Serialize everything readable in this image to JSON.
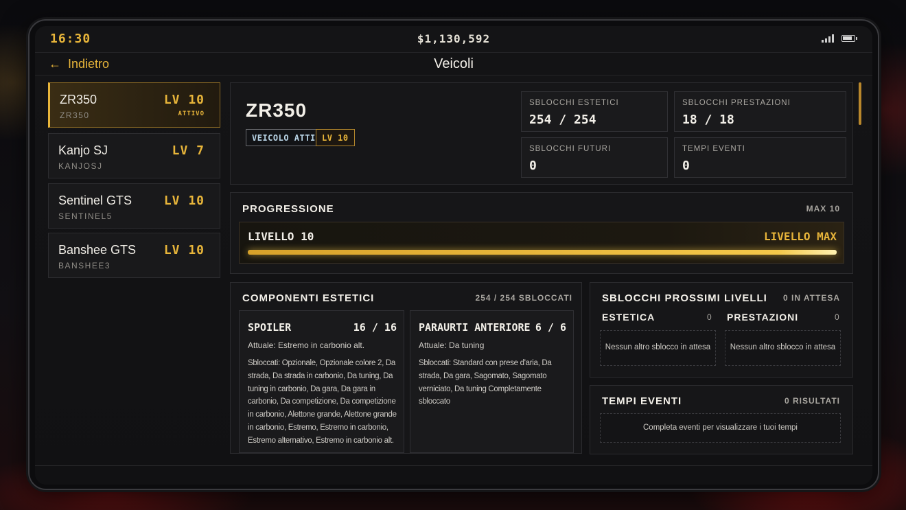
{
  "status": {
    "time": "16:30",
    "money": "$1,130,592"
  },
  "header": {
    "back_label": "Indietro",
    "title": "Veicoli"
  },
  "vehicles": [
    {
      "name": "ZR350",
      "sub": "ZR350",
      "level": "LV 10",
      "badge": "ATTIVO"
    },
    {
      "name": "Kanjo SJ",
      "sub": "KANJOSJ",
      "level": "LV 7"
    },
    {
      "name": "Sentinel GTS",
      "sub": "SENTINEL5",
      "level": "LV 10"
    },
    {
      "name": "Banshee GTS",
      "sub": "BANSHEE3",
      "level": "LV 10"
    }
  ],
  "selected": {
    "name": "ZR350",
    "tag_active": "VEICOLO ATTIVO",
    "tag_level": "LV 10",
    "stats": [
      {
        "label": "SBLOCCHI ESTETICI",
        "value": "254 / 254"
      },
      {
        "label": "SBLOCCHI PRESTAZIONI",
        "value": "18 / 18"
      },
      {
        "label": "SBLOCCHI FUTURI",
        "value": "0"
      },
      {
        "label": "TEMPI EVENTI",
        "value": "0"
      }
    ]
  },
  "progression": {
    "title": "PROGRESSIONE",
    "max_label": "MAX 10",
    "level_label": "LIVELLO 10",
    "right_label": "LIVELLO MAX",
    "progress_fraction": 1.0
  },
  "cosmetics": {
    "title": "COMPONENTI ESTETICI",
    "summary": "254 / 254 SBLOCCATI",
    "items": [
      {
        "name": "SPOILER",
        "count": "16 / 16",
        "current": "Attuale: Estremo in carbonio alt.",
        "unlocked": "Sbloccati: Opzionale, Opzionale colore 2, Da strada, Da strada in carbonio, Da tuning, Da tuning in carbonio, Da gara, Da gara in carbonio, Da competizione, Da competizione in carbonio, Alettone grande, Alettone grande in carbonio, Estremo, Estremo in carbonio, Estremo alternativo, Estremo in carbonio alt."
      },
      {
        "name": "PARAURTI ANTERIORE",
        "count": "6 / 6",
        "current": "Attuale: Da tuning",
        "unlocked": "Sbloccati: Standard con prese d'aria, Da strada, Da gara, Sagomato, Sagomato verniciato, Da tuning Completamente sbloccato"
      }
    ]
  },
  "next_unlocks": {
    "title": "SBLOCCHI PROSSIMI LIVELLI",
    "pending": "0 IN ATTESA",
    "cosmetic_label": "ESTETICA",
    "cosmetic_count": "0",
    "performance_label": "PRESTAZIONI",
    "performance_count": "0",
    "cosmetic_empty": "Nessun altro sblocco in attesa",
    "performance_empty": "Nessun altro sblocco in attesa"
  },
  "event_times": {
    "title": "TEMPI EVENTI",
    "results": "0 RISULTATI",
    "empty": "Completa eventi per visualizzare i tuoi tempi"
  },
  "colors": {
    "accent": "#e8b53a",
    "panel": "#161618",
    "background": "#111113"
  }
}
